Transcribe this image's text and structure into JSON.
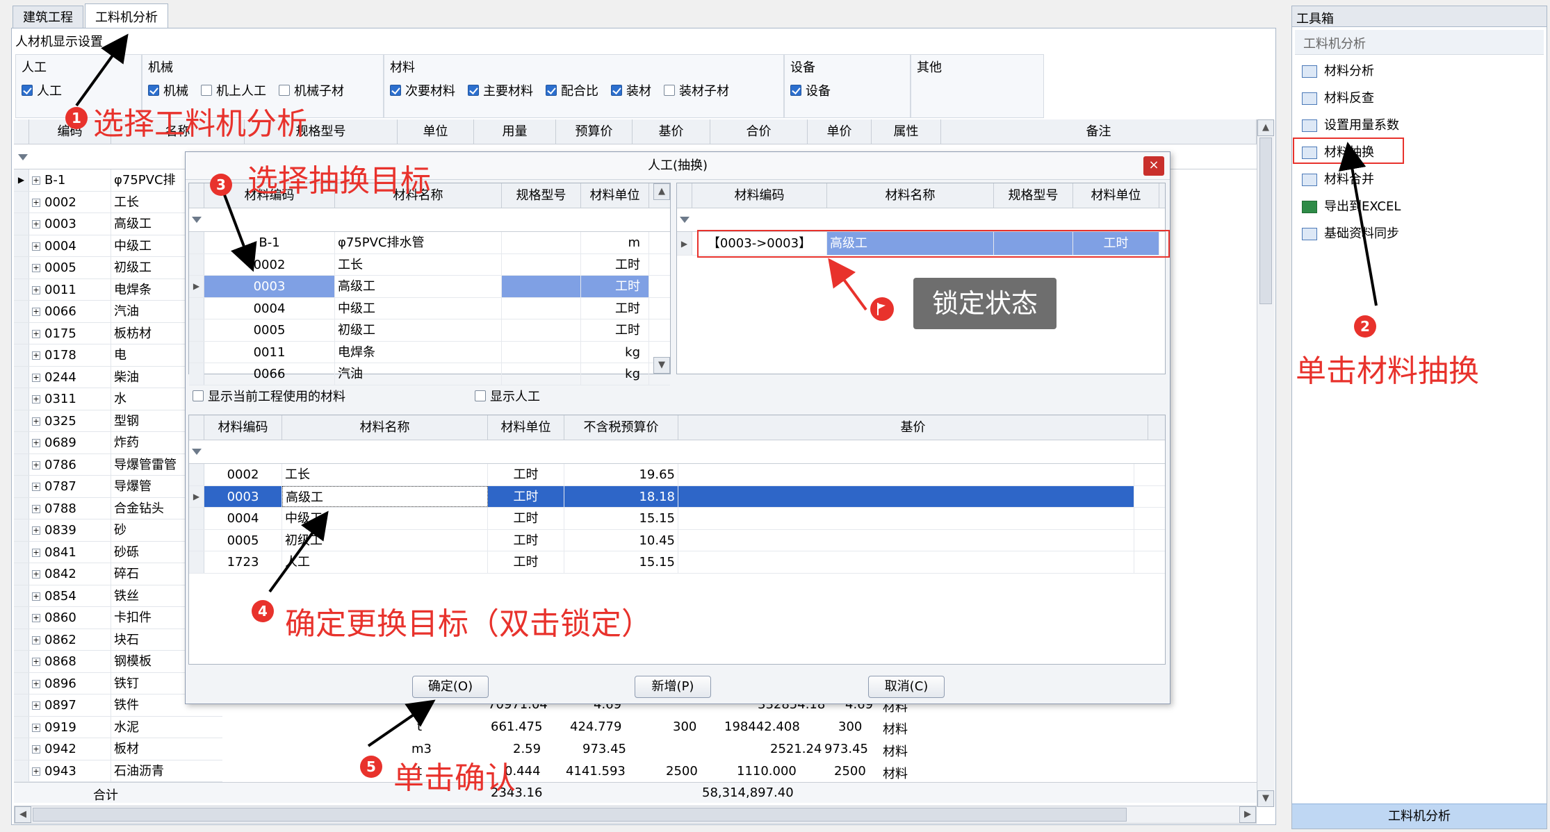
{
  "tabs": [
    "建筑工程",
    "工料机分析"
  ],
  "settings": {
    "title": "人材机显示设置",
    "groups": [
      {
        "label": "人工",
        "items": [
          {
            "label": "人工",
            "checked": true
          }
        ]
      },
      {
        "label": "机械",
        "items": [
          {
            "label": "机械",
            "checked": true
          },
          {
            "label": "机上人工",
            "checked": false
          },
          {
            "label": "机械子材",
            "checked": false
          }
        ]
      },
      {
        "label": "材料",
        "items": [
          {
            "label": "次要材料",
            "checked": true
          },
          {
            "label": "主要材料",
            "checked": true
          },
          {
            "label": "配合比",
            "checked": true
          },
          {
            "label": "装材",
            "checked": true
          },
          {
            "label": "装材子材",
            "checked": false
          }
        ]
      },
      {
        "label": "设备",
        "items": [
          {
            "label": "设备",
            "checked": true
          }
        ]
      },
      {
        "label": "其他",
        "items": []
      }
    ]
  },
  "main_grid": {
    "columns": [
      "编码",
      "名称",
      "规格型号",
      "单位",
      "用量",
      "预算价",
      "基价",
      "合价",
      "单价",
      "属性",
      "备注"
    ],
    "rows": [
      {
        "code": "B-1",
        "name": "φ75PVC排"
      },
      {
        "code": "0002",
        "name": "工长"
      },
      {
        "code": "0003",
        "name": "高级工"
      },
      {
        "code": "0004",
        "name": "中级工"
      },
      {
        "code": "0005",
        "name": "初级工"
      },
      {
        "code": "0011",
        "name": "电焊条"
      },
      {
        "code": "0066",
        "name": "汽油"
      },
      {
        "code": "0175",
        "name": "板枋材"
      },
      {
        "code": "0178",
        "name": "电"
      },
      {
        "code": "0244",
        "name": "柴油"
      },
      {
        "code": "0311",
        "name": "水"
      },
      {
        "code": "0325",
        "name": "型钢"
      },
      {
        "code": "0689",
        "name": "炸药"
      },
      {
        "code": "0786",
        "name": "导爆管雷管"
      },
      {
        "code": "0787",
        "name": "导爆管"
      },
      {
        "code": "0788",
        "name": "合金钻头"
      },
      {
        "code": "0839",
        "name": "砂"
      },
      {
        "code": "0841",
        "name": "砂砾"
      },
      {
        "code": "0842",
        "name": "碎石"
      },
      {
        "code": "0854",
        "name": "铁丝"
      },
      {
        "code": "0860",
        "name": "卡扣件"
      },
      {
        "code": "0862",
        "name": "块石"
      },
      {
        "code": "0868",
        "name": "钢模板"
      },
      {
        "code": "0896",
        "name": "铁钉"
      },
      {
        "code": "0897",
        "name": "铁件"
      },
      {
        "code": "0919",
        "name": "水泥"
      },
      {
        "code": "0942",
        "name": "板材"
      },
      {
        "code": "0943",
        "name": "石油沥青"
      }
    ],
    "partial_row_0897": {
      "qty": "70971.04",
      "price": "4.69",
      "total": "332854.18",
      "unit_price": "4.69",
      "attr": "材料"
    },
    "row_0919": {
      "unit": "t",
      "qty": "661.475",
      "price": "424.779",
      "base": "300",
      "total": "198442.408",
      "unit_price": "300",
      "attr": "材料"
    },
    "row_0942": {
      "unit": "m3",
      "qty": "2.59",
      "price": "973.45",
      "total": "2521.24",
      "unit_price": "973.45",
      "attr": "材料"
    },
    "row_0943": {
      "unit": "t",
      "qty": "0.444",
      "price": "4141.593",
      "base": "2500",
      "total": "1110.000",
      "unit_price": "2500",
      "attr": "材料"
    },
    "sum_label": "合计",
    "sum_qty": "2343.16",
    "sum_total": "58,314,897.40"
  },
  "toolbox": {
    "title": "工具箱",
    "section": "工料机分析",
    "items": [
      "材料分析",
      "材料反查",
      "设置用量系数",
      "材料抽换",
      "材料合并",
      "导出到EXCEL",
      "基础资料同步"
    ],
    "footer": "工料机分析"
  },
  "dialog": {
    "title": "人工(抽换)",
    "close": "×",
    "source_grid": {
      "columns": [
        "材料编码",
        "材料名称",
        "规格型号",
        "材料单位"
      ],
      "rows": [
        {
          "code": "B-1",
          "name": "φ75PVC排水管",
          "spec": "",
          "unit": "m"
        },
        {
          "code": "0002",
          "name": "工长",
          "spec": "",
          "unit": "工时"
        },
        {
          "code": "0003",
          "name": "高级工",
          "spec": "",
          "unit": "工时"
        },
        {
          "code": "0004",
          "name": "中级工",
          "spec": "",
          "unit": "工时"
        },
        {
          "code": "0005",
          "name": "初级工",
          "spec": "",
          "unit": "工时"
        },
        {
          "code": "0011",
          "name": "电焊条",
          "spec": "",
          "unit": "kg"
        },
        {
          "code": "0066",
          "name": "汽油",
          "spec": "",
          "unit": "kg"
        }
      ]
    },
    "target_grid": {
      "columns": [
        "材料编码",
        "材料名称",
        "规格型号",
        "材料单位"
      ],
      "row": {
        "code": "【0003->0003】",
        "name": "高级工",
        "spec": "",
        "unit": "工时"
      }
    },
    "options": [
      {
        "label": "显示当前工程使用的材料",
        "checked": false
      },
      {
        "label": "显示人工",
        "checked": false
      }
    ],
    "material_grid": {
      "columns": [
        "材料编码",
        "材料名称",
        "材料单位",
        "不含税预算价",
        "基价"
      ],
      "rows": [
        {
          "code": "0002",
          "name": "工长",
          "unit": "工时",
          "price": "19.65",
          "base": ""
        },
        {
          "code": "0003",
          "name": "高级工",
          "unit": "工时",
          "price": "18.18",
          "base": ""
        },
        {
          "code": "0004",
          "name": "中级工",
          "unit": "工时",
          "price": "15.15",
          "base": ""
        },
        {
          "code": "0005",
          "name": "初级工",
          "unit": "工时",
          "price": "10.45",
          "base": ""
        },
        {
          "code": "1723",
          "name": "人工",
          "unit": "工时",
          "price": "15.15",
          "base": ""
        }
      ]
    },
    "buttons": {
      "ok": "确定(O)",
      "add": "新增(P)",
      "cancel": "取消(C)"
    }
  },
  "annotations": {
    "a1": "选择工料机分析",
    "a2": "单击材料抽换",
    "a3": "选择抽换目标",
    "a4": "确定更换目标（双击锁定）",
    "a5": "单击确认",
    "lock": "锁定状态",
    "nums": [
      "1",
      "2",
      "3",
      "4",
      "5"
    ]
  },
  "colors": {
    "accent": "#e8322c",
    "selection": "#7fa0e4",
    "selection_strong": "#2e66c8"
  }
}
